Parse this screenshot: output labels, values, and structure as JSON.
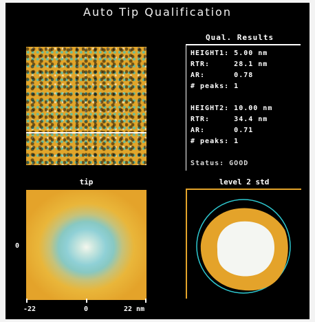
{
  "title": "Auto Tip Qualification",
  "results": {
    "header": "Qual. Results",
    "height1": "HEIGHT1: 5.00 nm",
    "rtr1": "RTR:     28.1 nm",
    "ar1": "AR:      0.78",
    "peaks1": "# peaks: 1",
    "height2": "HEIGHT2: 10.00 nm",
    "rtr2": "RTR:     34.4 nm",
    "ar2": "AR:      0.71",
    "peaks2": "# peaks: 1",
    "status": "Status: GOOD"
  },
  "tip_panel": {
    "label": "tip",
    "y_axis_label": "0",
    "x_ticks": [
      "-22",
      "0",
      "22 nm"
    ]
  },
  "level_panel": {
    "label": "level 2 std"
  },
  "colors": {
    "background": "#000000",
    "orange": "#e4a32a",
    "cyan": "#2ec8d0",
    "white": "#f4f6f2"
  }
}
